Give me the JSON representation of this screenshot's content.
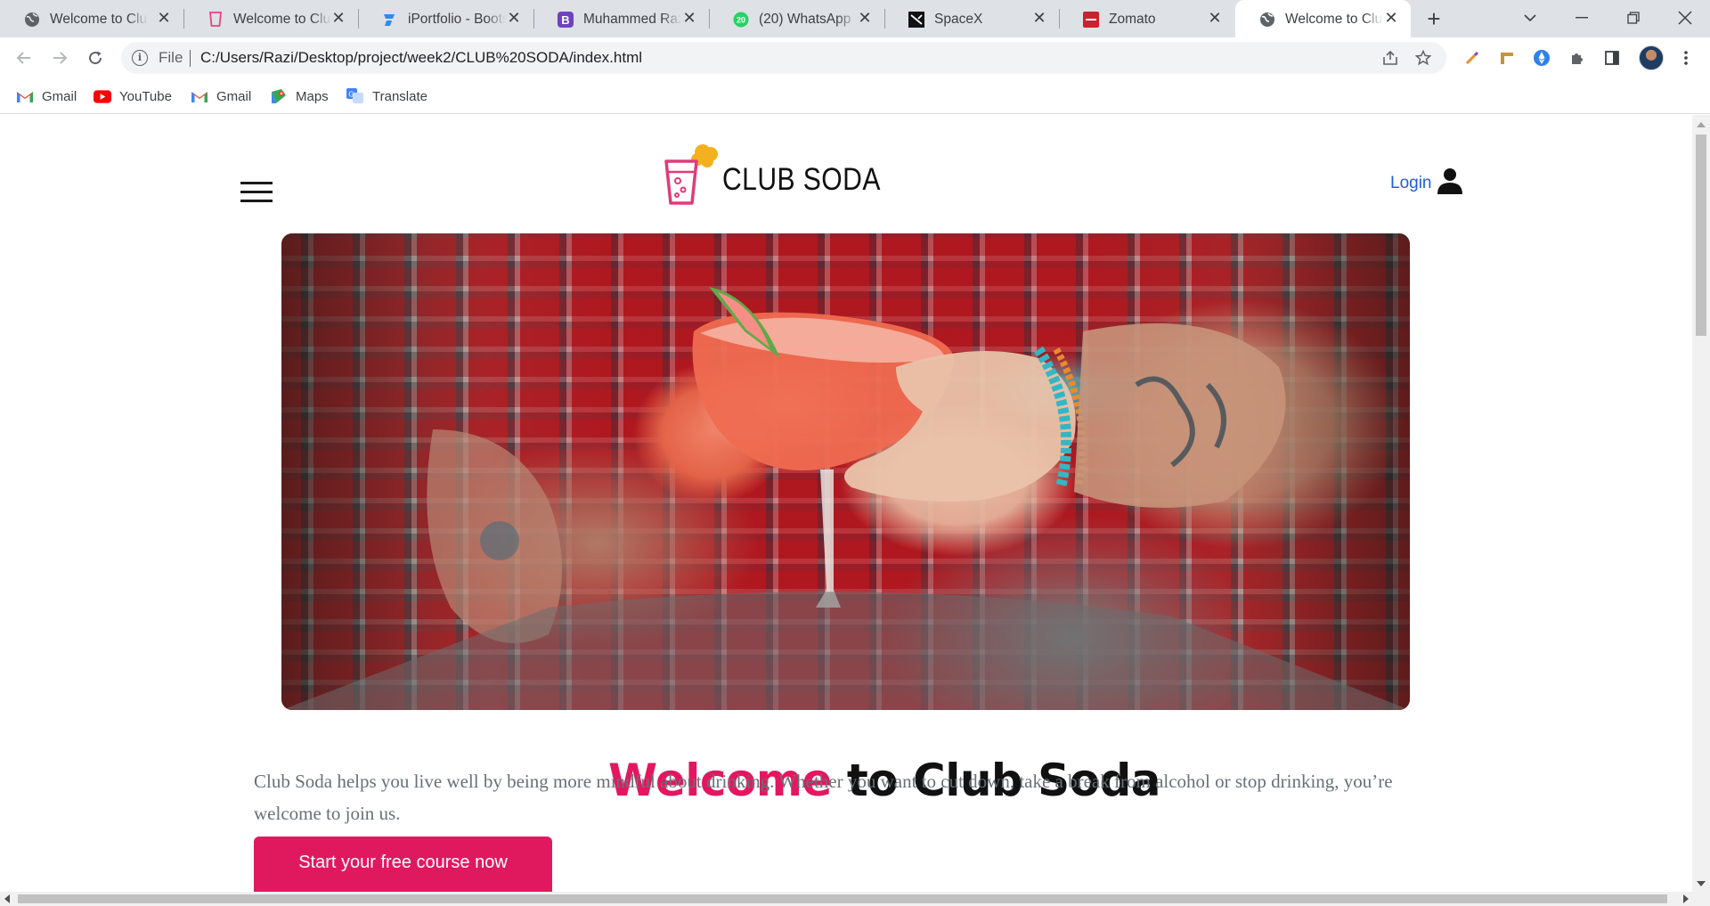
{
  "browser": {
    "tabs": [
      {
        "title": "Welcome to Club Soda",
        "favicon": "globe-icon",
        "active": false
      },
      {
        "title": "Welcome to Club Soda",
        "favicon": "club-soda-icon",
        "active": false
      },
      {
        "title": "iPortfolio - Bootstrap",
        "favicon": "iportfolio-icon",
        "active": false
      },
      {
        "title": "Muhammed Razi",
        "favicon": "bootstrap-icon",
        "active": false
      },
      {
        "title": "(20) WhatsApp",
        "favicon": "whatsapp-icon",
        "active": false
      },
      {
        "title": "SpaceX",
        "favicon": "spacex-icon",
        "active": false
      },
      {
        "title": "Zomato",
        "favicon": "zomato-icon",
        "active": false
      },
      {
        "title": "Welcome to Club Soda",
        "favicon": "globe-icon",
        "active": true
      }
    ],
    "address": {
      "scheme_label": "File",
      "url": "C:/Users/Razi/Desktop/project/week2/CLUB%20SODA/index.html"
    },
    "bookmarks": [
      {
        "label": "Gmail",
        "icon": "gmail-icon"
      },
      {
        "label": "YouTube",
        "icon": "youtube-icon"
      },
      {
        "label": "Gmail",
        "icon": "gmail-icon"
      },
      {
        "label": "Maps",
        "icon": "maps-icon"
      },
      {
        "label": "Translate",
        "icon": "translate-icon"
      }
    ]
  },
  "site": {
    "logo_text": "CLUB SODA",
    "login_label": "Login",
    "hero": {
      "title_accent": "Welcome",
      "title_rest": "to Club Soda"
    },
    "intro": "Club Soda helps you live well by being more mindful about drinking. Whether you want to cut down, take a break from alcohol or stop drinking, you’re welcome to join us.",
    "cta_label": "Start your free course now"
  },
  "colors": {
    "accent": "#e5165f",
    "cta": "#e0195f",
    "login_link": "#1f5fd6"
  }
}
